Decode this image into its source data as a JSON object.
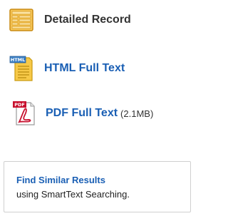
{
  "links": {
    "detailed_record": "Detailed Record",
    "html_full_text": "HTML Full Text",
    "pdf_full_text": "PDF Full Text",
    "pdf_size": "(2.1MB)"
  },
  "icons": {
    "html_badge": "HTML",
    "pdf_badge": "PDF"
  },
  "similar": {
    "title": "Find Similar Results",
    "subtitle": "using SmartText Searching."
  },
  "colors": {
    "link": "#1a5fb4",
    "text": "#333333",
    "pdf_red": "#c8102e",
    "record_orange": "#e8a317"
  }
}
